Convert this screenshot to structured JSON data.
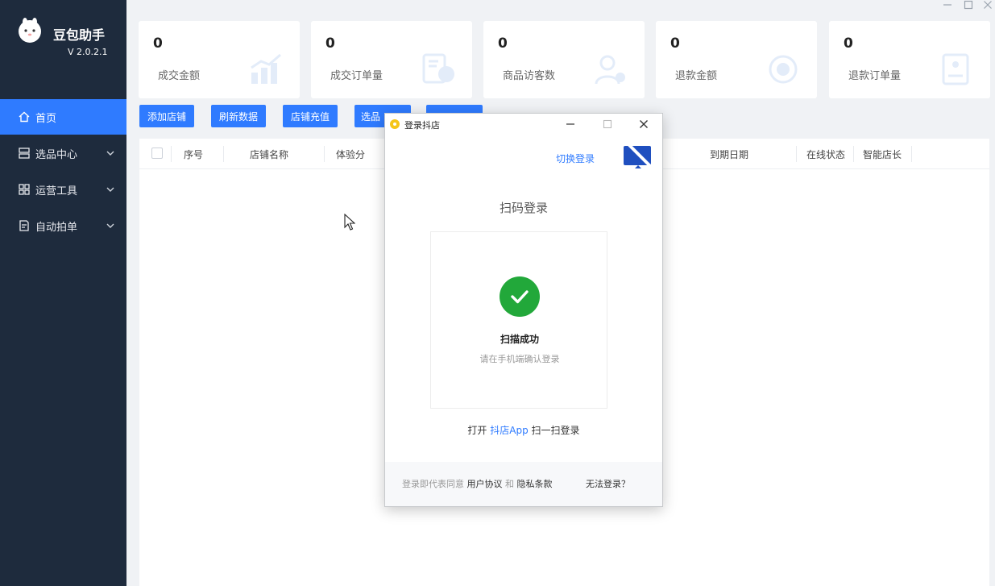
{
  "app": {
    "name": "豆包助手",
    "version": "V 2.0.2.1"
  },
  "sidebar": {
    "items": [
      {
        "label": "首页",
        "icon": "home-icon",
        "active": true
      },
      {
        "label": "选品中心",
        "icon": "product-center-icon"
      },
      {
        "label": "运营工具",
        "icon": "grid-tools-icon"
      },
      {
        "label": "自动拍单",
        "icon": "document-icon"
      }
    ]
  },
  "stats": [
    {
      "value": "0",
      "label": "成交金额",
      "icon": "bar-chart-icon"
    },
    {
      "value": "0",
      "label": "成交订单量",
      "icon": "order-chart-icon"
    },
    {
      "value": "0",
      "label": "商品访客数",
      "icon": "visitor-icon"
    },
    {
      "value": "0",
      "label": "退款金额",
      "icon": "refund-icon"
    },
    {
      "value": "0",
      "label": "退款订单量",
      "icon": "refund-order-icon"
    }
  ],
  "actions": [
    "添加店铺",
    "刷新数据",
    "店铺充值",
    "选品"
  ],
  "table": {
    "columns": [
      "序号",
      "店铺名称",
      "体验分",
      "到期日期",
      "在线状态",
      "智能店长"
    ]
  },
  "dialog": {
    "title": "登录抖店",
    "switch_login": "切换登录",
    "scan_title": "扫码登录",
    "scan_success": "扫描成功",
    "scan_hint": "请在手机端确认登录",
    "open_prefix": "打开",
    "open_app": "抖店App",
    "open_suffix": "扫一扫登录",
    "agree_prefix": "登录即代表同意",
    "user_agreement": "用户协议",
    "and": "和",
    "privacy": "隐私条款",
    "cant_login": "无法登录？"
  },
  "colors": {
    "sidebar": "#1e2b3d",
    "accent": "#2f7bff",
    "success": "#22a83a"
  }
}
